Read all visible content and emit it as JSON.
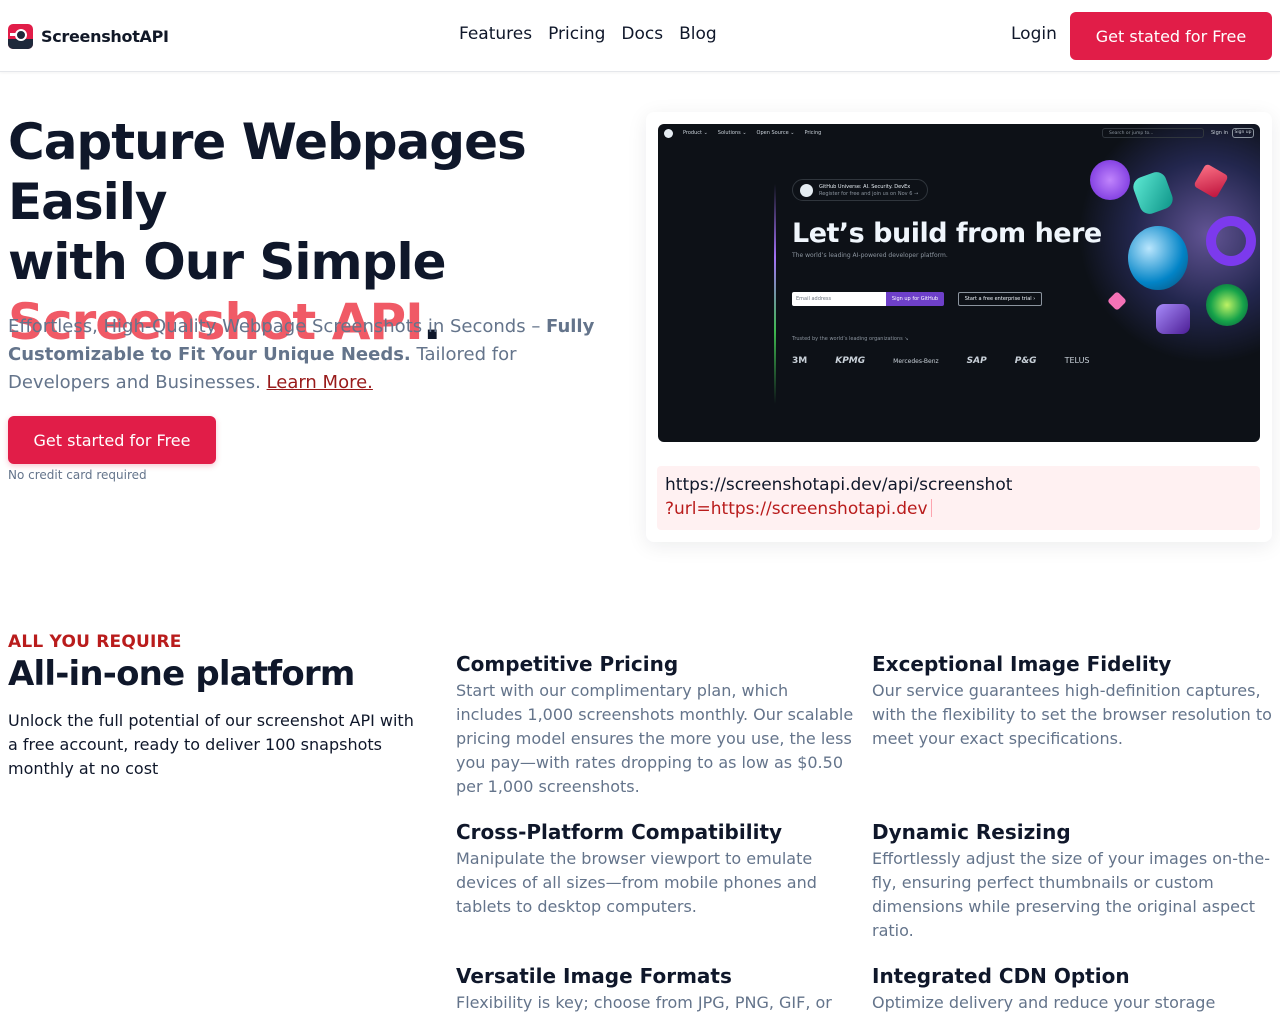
{
  "header": {
    "brand": "ScreenshotAPI",
    "nav": [
      "Features",
      "Pricing",
      "Docs",
      "Blog"
    ],
    "login": "Login",
    "cta": "Get stated for Free"
  },
  "hero": {
    "title_line1": "Capture Webpages Easily",
    "title_line2": "with Our Simple",
    "title_accent": "Screenshot API",
    "title_period": ".",
    "sub_plain1": "Effortless, High-Quality Webpage Screenshots in Seconds – ",
    "sub_bold": "Fully Customizable to Fit Your Unique Needs.",
    "sub_plain2": " Tailored for Developers and Businesses. ",
    "sub_link": "Learn More.",
    "cta": "Get started for Free",
    "note": "No credit card required"
  },
  "preview": {
    "nav_items": [
      "Product ⌄",
      "Solutions ⌄",
      "Open Source ⌄",
      "Pricing"
    ],
    "search_placeholder": "Search or jump to...",
    "signin": "Sign in",
    "signup": "Sign up",
    "badge_line1": "GitHub Universe: AI. Security. DevEx",
    "badge_line2": "Register for free and join us on Nov 6 →",
    "headline": "Let’s build from here",
    "subhead": "The world’s leading AI-powered developer platform.",
    "email_placeholder": "Email address",
    "signup_button": "Sign up for GitHub",
    "trial_button": "Start a free enterprise trial ›",
    "trusted": "Trusted by the world’s leading organizations ↘",
    "logos": [
      "3M",
      "KPMG",
      "Mercedes-Benz",
      "SAP",
      "P&G",
      "TELUS"
    ],
    "url_base": "https://screenshotapi.dev/api/screenshot",
    "url_param": "?url=https://screenshotapi.dev"
  },
  "features": {
    "eyebrow": "ALL YOU REQUIRE",
    "title": "All-in-one platform",
    "desc": "Unlock the full potential of our screenshot API with a free account, ready to deliver 100 snapshots monthly at no cost",
    "items": [
      {
        "title": "Competitive Pricing",
        "body": "Start with our complimentary plan, which includes 1,000 screenshots monthly. Our scalable pricing model ensures the more you use, the less you pay—with rates dropping to as low as $0.50 per 1,000 screenshots."
      },
      {
        "title": "Exceptional Image Fidelity",
        "body": "Our service guarantees high-definition captures, with the flexibility to set the browser resolution to meet your exact specifications."
      },
      {
        "title": "Cross-Platform Compatibility",
        "body": "Manipulate the browser viewport to emulate devices of all sizes—from mobile phones and tablets to desktop computers."
      },
      {
        "title": "Dynamic Resizing",
        "body": "Effortlessly adjust the size of your images on-the-fly, ensuring perfect thumbnails or custom dimensions while preserving the original aspect ratio."
      },
      {
        "title": "Versatile Image Formats",
        "body": "Flexibility is key; choose from JPG, PNG, GIF, or"
      },
      {
        "title": "Integrated CDN Option",
        "body": "Optimize delivery and reduce your storage"
      }
    ]
  },
  "colors": {
    "accent": "#e11d48",
    "accent_soft": "#f05a66",
    "link": "#991b1b",
    "muted": "#64748b"
  }
}
